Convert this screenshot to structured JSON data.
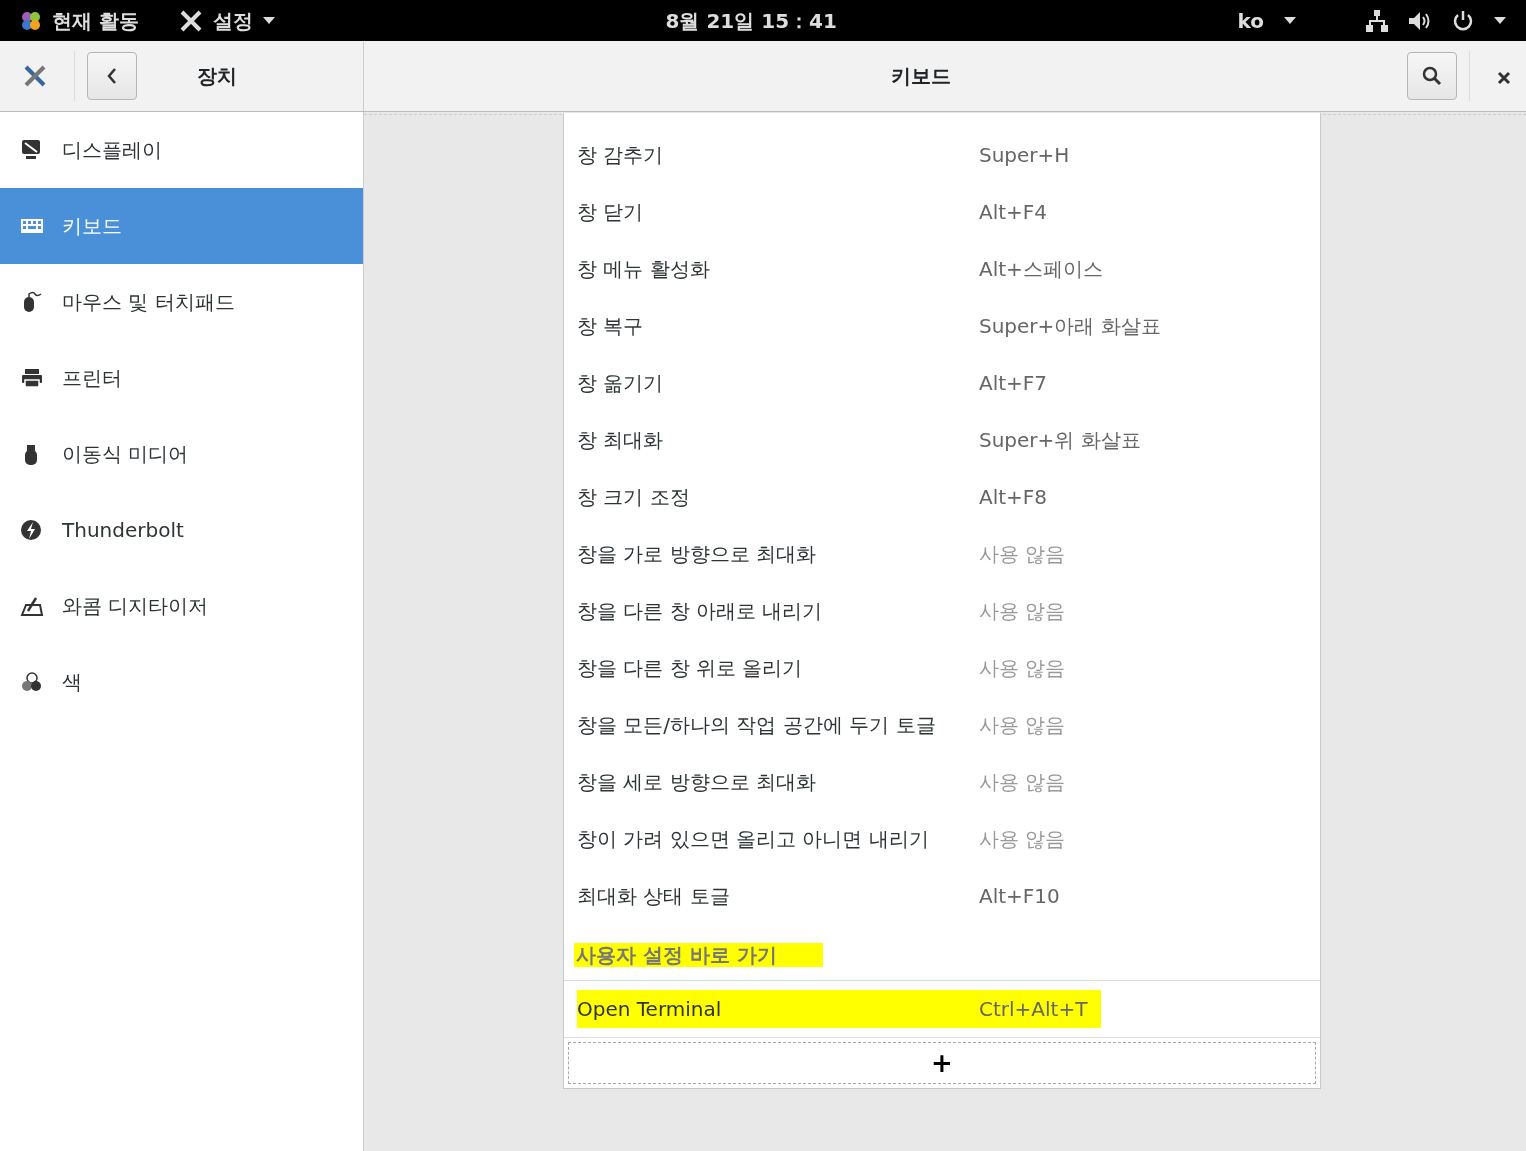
{
  "top_bar": {
    "activities": "현재 활동",
    "app_menu": "설정",
    "clock": "8월 21일  15：41",
    "input_method": "ko"
  },
  "header": {
    "section_title": "장치",
    "page_title": "키보드"
  },
  "sidebar": {
    "items": [
      {
        "label": "디스플레이",
        "kind": "display",
        "selected": false
      },
      {
        "label": "키보드",
        "kind": "keyboard",
        "selected": true
      },
      {
        "label": "마우스 및 터치패드",
        "kind": "mouse",
        "selected": false
      },
      {
        "label": "프린터",
        "kind": "printer",
        "selected": false
      },
      {
        "label": "이동식 미디어",
        "kind": "usb",
        "selected": false
      },
      {
        "label": "Thunderbolt",
        "kind": "bolt",
        "selected": false
      },
      {
        "label": "와콤 디지타이저",
        "kind": "tablet",
        "selected": false
      },
      {
        "label": "색",
        "kind": "color",
        "selected": false
      }
    ]
  },
  "shortcuts": [
    {
      "name": "창 감추기",
      "accel": "Super+H",
      "disabled": false
    },
    {
      "name": "창 닫기",
      "accel": "Alt+F4",
      "disabled": false
    },
    {
      "name": "창 메뉴 활성화",
      "accel": "Alt+스페이스",
      "disabled": false
    },
    {
      "name": "창 복구",
      "accel": "Super+아래 화살표",
      "disabled": false
    },
    {
      "name": "창 옮기기",
      "accel": "Alt+F7",
      "disabled": false
    },
    {
      "name": "창 최대화",
      "accel": "Super+위 화살표",
      "disabled": false
    },
    {
      "name": "창 크기 조정",
      "accel": "Alt+F8",
      "disabled": false
    },
    {
      "name": "창을 가로 방향으로 최대화",
      "accel": "사용 않음",
      "disabled": true
    },
    {
      "name": "창을 다른 창 아래로 내리기",
      "accel": "사용 않음",
      "disabled": true
    },
    {
      "name": "창을 다른 창 위로 올리기",
      "accel": "사용 않음",
      "disabled": true
    },
    {
      "name": "창을 모든/하나의 작업 공간에 두기 토글",
      "accel": "사용 않음",
      "disabled": true
    },
    {
      "name": "창을 세로 방향으로 최대화",
      "accel": "사용 않음",
      "disabled": true
    },
    {
      "name": "창이 가려 있으면 올리고 아니면 내리기",
      "accel": "사용 않음",
      "disabled": true
    },
    {
      "name": "최대화 상태 토글",
      "accel": "Alt+F10",
      "disabled": false
    }
  ],
  "custom_section": {
    "title": "사용자 설정 바로 가기",
    "highlighted": true,
    "shortcuts": [
      {
        "name": "Open Terminal",
        "accel": "Ctrl+Alt+T",
        "highlighted": true
      }
    ],
    "add_button": "+"
  }
}
